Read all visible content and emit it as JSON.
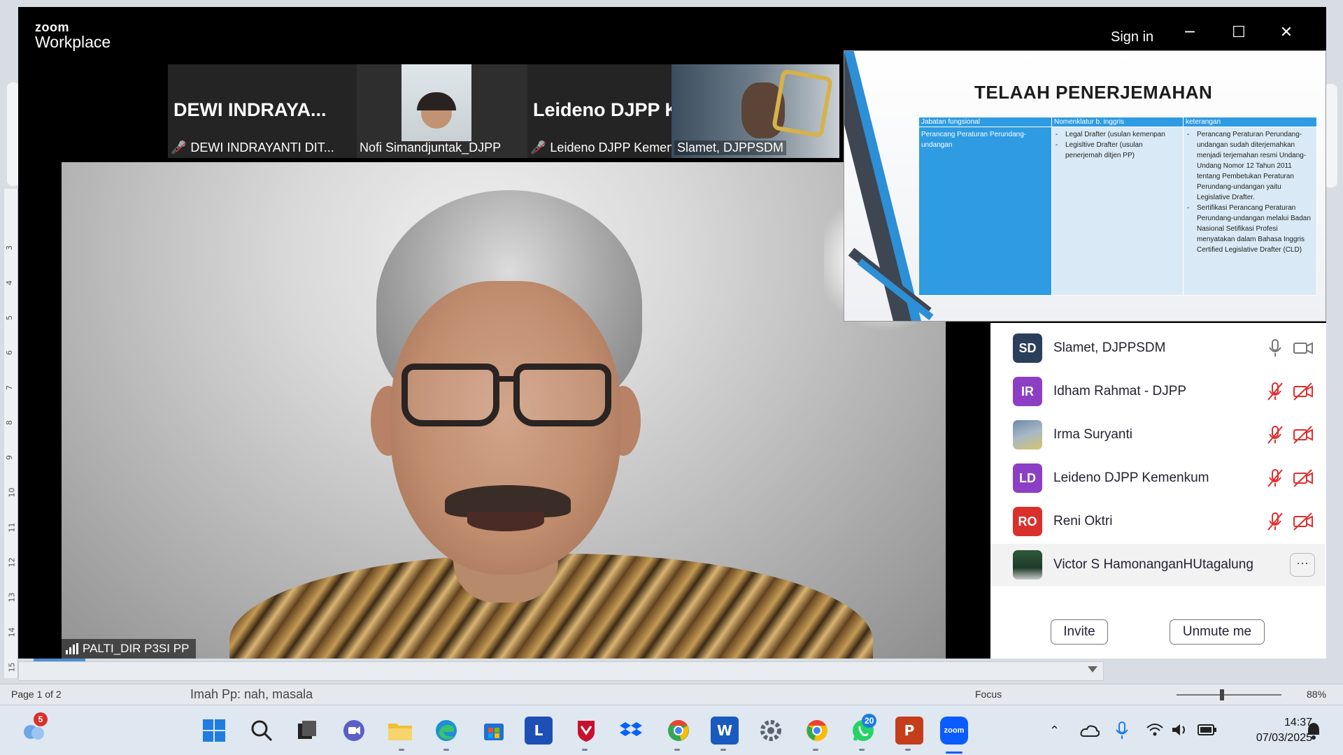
{
  "word": {
    "ruler_numbers": [
      "3",
      "4",
      "5",
      "6",
      "7",
      "8",
      "9",
      "10",
      "11",
      "12",
      "13",
      "14",
      "15"
    ],
    "status_page": "Page 1 of 2",
    "status_caption": "Imah Pp: nah, masala",
    "focus_label": "Focus",
    "zoom_level": "88%"
  },
  "zoom": {
    "logo_top": "zoom",
    "logo_bottom": "Workplace",
    "sign_in": "Sign in",
    "minimize_glyph": "─",
    "maximize_glyph": "☐",
    "close_glyph": "✕",
    "thumbnails": [
      {
        "big_name": "DEWI  INDRAYA...",
        "label": "DEWI INDRAYANTI DIT...",
        "muted": true
      },
      {
        "big_name": "",
        "label": "Nofi Simandjuntak_DJPP",
        "muted": false
      },
      {
        "big_name": "Leideno  DJPP  K...",
        "label": "Leideno DJPP Kemenk...",
        "muted": true
      },
      {
        "big_name": "",
        "label": "Slamet, DJPPSDM",
        "muted": false
      }
    ],
    "speaker_name": "PALTI_DIR P3SI PP",
    "slide": {
      "title": "TELAAH PENERJEMAHAN",
      "headers": [
        "Jabatan fungsional",
        "Nomenklatur b. inggris",
        "keterangan"
      ],
      "col1": "Perancang Peraturan Perundang-undangan",
      "col2_items": [
        "Legal Drafter (usulan kemenpan",
        "Legisltive Drafter (usulan penerjemah ditjen PP)"
      ],
      "col3_items": [
        "Perancang Peraturan Perundang-undangan sudah diterjemahkan menjadi terjemahan resmi Undang-Undang Nomor 12 Tahun 2011 tentang Pembetukan Peraturan Perundang-undangan yaitu Legislative Drafter.",
        "Sertifikasi Perancang Peraturan Perundang-undangan melalui Badan Nasional Setifikasi Profesi menyatakan dalam Bahasa Inggris Certified Legislative Drafter (CLD)"
      ]
    },
    "participants": [
      {
        "initials": "SD",
        "name": "Slamet, DJPPSDM",
        "color": "#2b3f5c",
        "muted": false,
        "photo": false
      },
      {
        "initials": "IR",
        "name": "Idham Rahmat - DJPP",
        "color": "#8c3fc4",
        "muted": true,
        "photo": false
      },
      {
        "initials": "",
        "name": "Irma Suryanti",
        "color": "#6e8aa6",
        "muted": true,
        "photo": true
      },
      {
        "initials": "LD",
        "name": "Leideno DJPP Kemenkum",
        "color": "#8c3fc4",
        "muted": true,
        "photo": false
      },
      {
        "initials": "RO",
        "name": "Reni Oktri",
        "color": "#d9302c",
        "muted": true,
        "photo": false
      },
      {
        "initials": "",
        "name": "Victor S HamonanganHUtagalung",
        "color": "#1d3a2a",
        "muted": false,
        "photo": true,
        "highlight": true
      }
    ],
    "more_glyph": "···",
    "invite_label": "Invite",
    "unmute_label": "Unmute me"
  },
  "taskbar": {
    "weather_badge": "5",
    "whatsapp_badge": "20",
    "word_letter": "W",
    "powerpoint_letter": "P",
    "l_app_letter": "L",
    "zoom_app_label": "zoom",
    "time": "14:37",
    "date": "07/03/2025",
    "icons": [
      "weather-icon",
      "start-icon",
      "search-icon",
      "task-view-icon",
      "meet-icon",
      "file-explorer-icon",
      "edge-icon",
      "store-icon",
      "l-app-icon",
      "mcafee-icon",
      "dropbox-icon",
      "chrome-icon",
      "word-icon",
      "settings-icon",
      "chrome-alt-icon",
      "whatsapp-icon",
      "powerpoint-icon",
      "zoom-app-icon"
    ]
  }
}
